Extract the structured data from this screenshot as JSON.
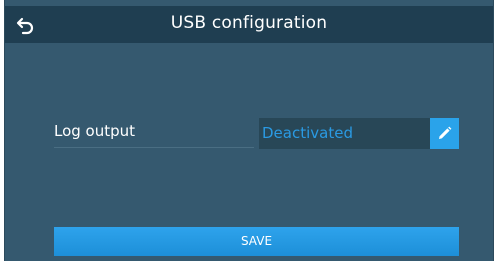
{
  "header": {
    "title": "USB configuration",
    "back_icon": "back-arrow-icon"
  },
  "settings": {
    "log_output": {
      "label": "Log output",
      "value": "Deactivated",
      "edit_icon": "pencil-icon"
    }
  },
  "actions": {
    "save_label": "SAVE"
  },
  "colors": {
    "background": "#35596f",
    "header": "#1f3e51",
    "accent": "#2aa3ea",
    "value_text": "#2a9ae3"
  }
}
